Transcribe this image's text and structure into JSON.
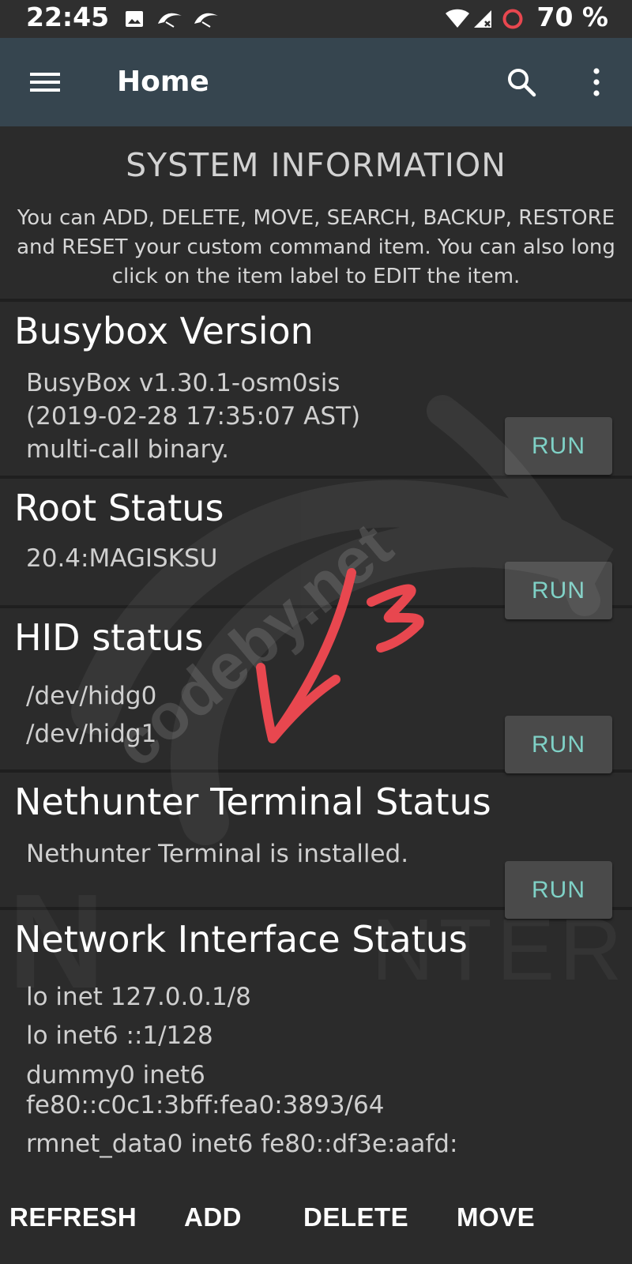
{
  "status_bar": {
    "time": "22:45",
    "battery": "70 %",
    "icons": [
      "image-icon",
      "kali-dragon-icon",
      "kali-dragon-icon",
      "wifi-icon",
      "no-signal-icon",
      "battery-ring-icon"
    ]
  },
  "app_bar": {
    "title": "Home",
    "menu_icon": "hamburger-menu-icon",
    "search_icon": "search-icon",
    "overflow_icon": "more-vert-icon",
    "color": "#36454f"
  },
  "header": {
    "title": "SYSTEM INFORMATION",
    "description": "You can ADD, DELETE, MOVE, SEARCH, BACKUP, RESTORE and RESET your custom command item. You can also long click on the item label to EDIT the item."
  },
  "items": [
    {
      "label": "Busybox Version",
      "output": [
        "BusyBox v1.30.1-osm0sis",
        "(2019-02-28 17:35:07 AST)",
        "multi-call binary."
      ],
      "button": "RUN"
    },
    {
      "label": "Root Status",
      "output": [
        "20.4:MAGISKSU"
      ],
      "button": "RUN"
    },
    {
      "label": "HID status",
      "output": [
        "/dev/hidg0",
        "/dev/hidg1"
      ],
      "button": "RUN"
    },
    {
      "label": "Nethunter Terminal Status",
      "output": [
        "Nethunter Terminal is installed."
      ],
      "button": "RUN"
    },
    {
      "label": "Network Interface Status",
      "output": [
        "lo inet 127.0.0.1/8",
        "lo inet6 ::1/128",
        "dummy0 inet6",
        "fe80::c0c1:3bff:fea0:3893/64",
        "rmnet_data0 inet6 fe80::df3e:aafd:"
      ]
    }
  ],
  "watermark": {
    "text": "codeby.net",
    "background_text": "NETHUNTER"
  },
  "bottom_bar": {
    "buttons": [
      "REFRESH",
      "ADD",
      "DELETE",
      "MOVE"
    ]
  },
  "colors": {
    "background": "#2b2b2b",
    "run_text": "#7fd1c6",
    "annotation": "#e8474f"
  }
}
